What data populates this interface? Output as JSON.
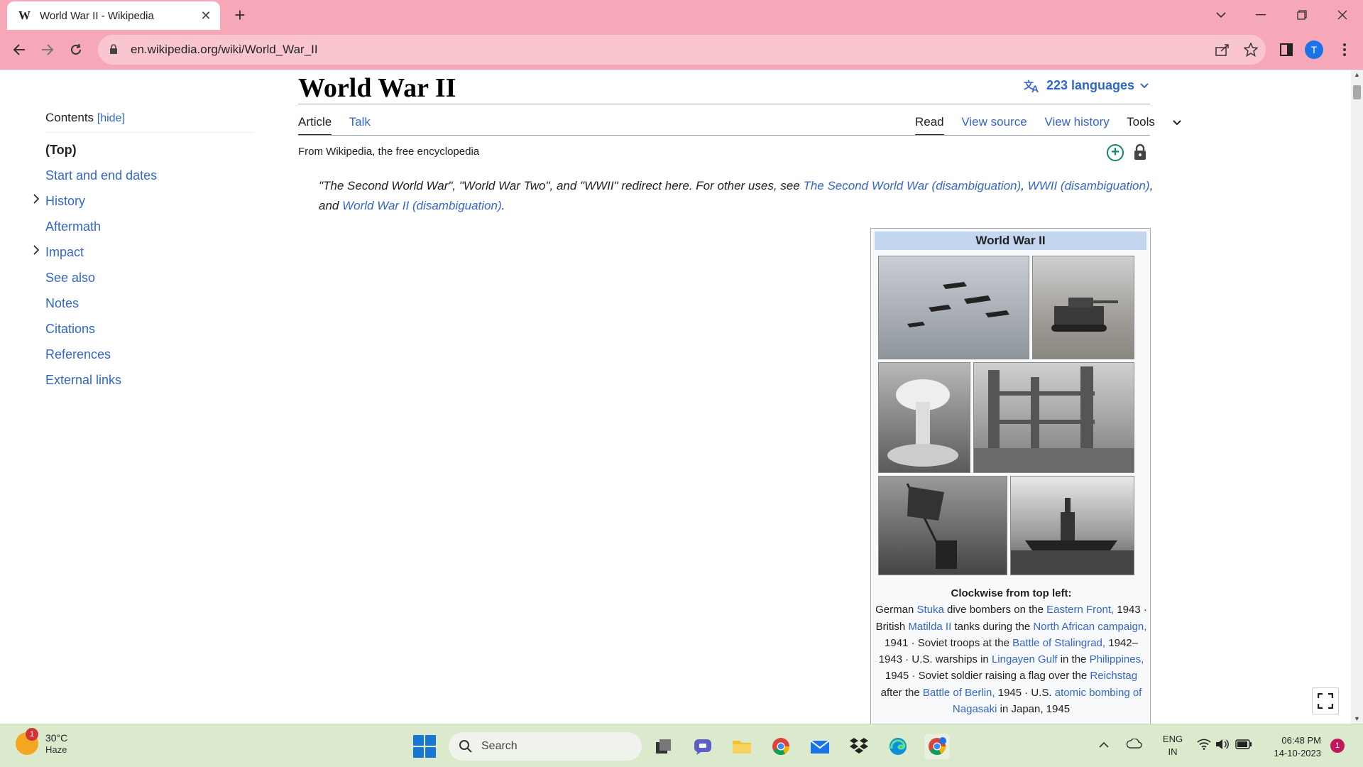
{
  "browser": {
    "tab_title": "World War II - Wikipedia",
    "favicon": "W",
    "url": "en.wikipedia.org/wiki/World_War_II",
    "profile_initial": "T"
  },
  "toc": {
    "heading": "Contents",
    "hide": "[hide]",
    "items": [
      {
        "label": "(Top)"
      },
      {
        "label": "Start and end dates"
      },
      {
        "label": "History"
      },
      {
        "label": "Aftermath"
      },
      {
        "label": "Impact"
      },
      {
        "label": "See also"
      },
      {
        "label": "Notes"
      },
      {
        "label": "Citations"
      },
      {
        "label": "References"
      },
      {
        "label": "External links"
      }
    ]
  },
  "article": {
    "title": "World War II",
    "languages": "223 languages",
    "tabs_left": [
      "Article",
      "Talk"
    ],
    "tabs_right": [
      "Read",
      "View source",
      "View history",
      "Tools"
    ],
    "tagline": "From Wikipedia, the free encyclopedia",
    "hatnote": {
      "t1": "\"The Second World War\", \"World War Two\", and \"WWII\" redirect here. For other uses, see ",
      "l1": "The Second World War (disambiguation)",
      "t2": ", ",
      "l2": "WWII (disambiguation)",
      "t3": ", and ",
      "l3": "World War II (disambiguation)",
      "t4": "."
    }
  },
  "infobox": {
    "title": "World War II",
    "caption_title": "Clockwise from top left:",
    "caption": {
      "c1": "German ",
      "l1": "Stuka",
      "c2": " dive bombers on the ",
      "l2": "Eastern Front,",
      "c3": " 1943 · British ",
      "l3": "Matilda II",
      "c4": " tanks during the ",
      "l4": "North African campaign,",
      "c5": " 1941 · Soviet troops at the ",
      "l5": "Battle of Stalingrad,",
      "c6": " 1942–1943 · U.S. warships in ",
      "l6": "Lingayen Gulf",
      "c7": " in the ",
      "l7": "Philippines,",
      "c8": " 1945 · Soviet soldier raising a flag over the ",
      "l8": "Reichstag",
      "c9": " after the ",
      "l9": "Battle of Berlin,",
      "c10": " 1945 · U.S. ",
      "l10": "atomic bombing of Nagasaki",
      "c11": " in Japan, 1945"
    }
  },
  "taskbar": {
    "temp": "30°C",
    "condition": "Haze",
    "weather_badge": "1",
    "search_placeholder": "Search",
    "lang1": "ENG",
    "lang2": "IN",
    "time": "06:48 PM",
    "date": "14-10-2023",
    "notifications": "1"
  },
  "colors": {
    "link": "#3366cc",
    "chrome_frame": "#f6a8b8",
    "taskbar": "#dbe9cc",
    "infobox_header": "#c3d6ef"
  }
}
